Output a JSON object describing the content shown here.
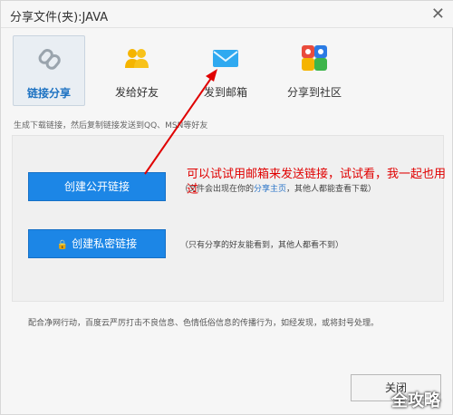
{
  "window": {
    "title": "分享文件(夹):JAVA",
    "close_glyph": "✕"
  },
  "tabs": [
    {
      "label": "链接分享",
      "icon": "link-icon",
      "active": true
    },
    {
      "label": "发给好友",
      "icon": "friends-icon",
      "active": false
    },
    {
      "label": "发到邮箱",
      "icon": "email-icon",
      "active": false
    },
    {
      "label": "分享到社区",
      "icon": "community-icon",
      "active": false
    }
  ],
  "description": "生成下载链接，然后复制链接发送到QQ、MSN等好友",
  "public_link": {
    "button_label": "创建公开链接",
    "hint_prefix": "（文件会出现在你的",
    "hint_link": "分享主页",
    "hint_suffix": "，其他人都能查看下载）"
  },
  "private_link": {
    "lock_glyph": "🔒",
    "button_label": "创建私密链接",
    "hint": "（只有分享的好友能看到，其他人都看不到）"
  },
  "notice": "配合净网行动，百度云严厉打击不良信息、色情低俗信息的传播行为，如经发现，或将封号处理。",
  "close_button_label": "关闭",
  "annotation": "可以试试用邮箱来发送链接，试试看，我一起也用过",
  "watermark": "全攻略",
  "colors": {
    "primary_button": "#1c86e6",
    "annotation": "#e00000",
    "link": "#2a74c8"
  }
}
